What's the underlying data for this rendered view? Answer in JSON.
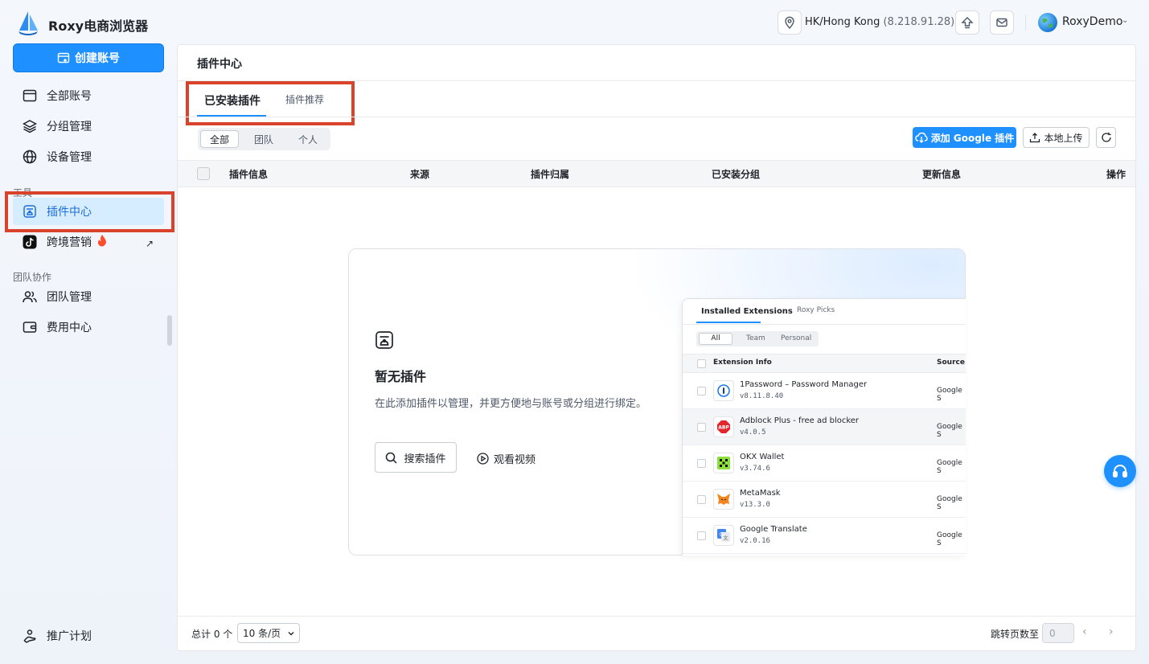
{
  "app": {
    "title": "Roxy电商浏览器"
  },
  "header": {
    "location": "HK/Hong Kong",
    "ip": "(8.218.91.28)",
    "user": "RoxyDemo"
  },
  "sidebar": {
    "create_label": "创建账号",
    "items": [
      {
        "label": "全部账号",
        "icon": "window-icon"
      },
      {
        "label": "分组管理",
        "icon": "layers-icon"
      },
      {
        "label": "设备管理",
        "icon": "globe-icon"
      }
    ],
    "section_tools": "工具",
    "tools": [
      {
        "label": "插件中心",
        "icon": "puzzle-icon",
        "active": true
      },
      {
        "label": "跨境营销",
        "icon": "tiktok-icon",
        "hot": true
      }
    ],
    "section_team": "团队协作",
    "team": [
      {
        "label": "团队管理",
        "icon": "users-icon"
      },
      {
        "label": "费用中心",
        "icon": "wallet-icon"
      }
    ],
    "bottom": {
      "label": "推广计划",
      "icon": "handshake-icon"
    }
  },
  "main": {
    "title": "插件中心",
    "tabs": [
      {
        "label": "已安装插件",
        "active": true
      },
      {
        "label": "插件推荐",
        "active": false
      }
    ],
    "filters": [
      {
        "label": "全部",
        "active": true
      },
      {
        "label": "团队",
        "active": false
      },
      {
        "label": "个人",
        "active": false
      }
    ],
    "actions": {
      "add_google": "添加 Google 插件",
      "local_upload": "本地上传"
    },
    "columns": [
      "插件信息",
      "来源",
      "插件归属",
      "已安装分组",
      "更新信息",
      "操作"
    ],
    "empty": {
      "title": "暂无插件",
      "desc": "在此添加插件以管理，并更方便地与账号或分组进行绑定。",
      "search_btn": "搜索插件",
      "video_link": "观看视频"
    },
    "preview": {
      "tabs": [
        "Installed Extensions",
        "Roxy Picks"
      ],
      "filters": [
        "All",
        "Team",
        "Personal"
      ],
      "col_info": "Extension Info",
      "col_source": "Source",
      "rows": [
        {
          "name": "1Password – Password Manager",
          "version": "v8.11.8.40",
          "source": "Google S"
        },
        {
          "name": "Adblock Plus - free ad blocker",
          "version": "v4.0.5",
          "source": "Google S"
        },
        {
          "name": "OKX Wallet",
          "version": "v3.74.6",
          "source": "Google S"
        },
        {
          "name": "MetaMask",
          "version": "v13.3.0",
          "source": "Google S"
        },
        {
          "name": "Google Translate",
          "version": "v2.0.16",
          "source": "Google S"
        }
      ]
    },
    "footer": {
      "total": "总计 0 个",
      "page_size": "10 条/页",
      "jump_label": "跳转页数至",
      "jump_value": "0"
    }
  },
  "colors": {
    "accent": "#1e90ff",
    "highlight": "#d9432c",
    "active_bg": "#d6ecff"
  }
}
